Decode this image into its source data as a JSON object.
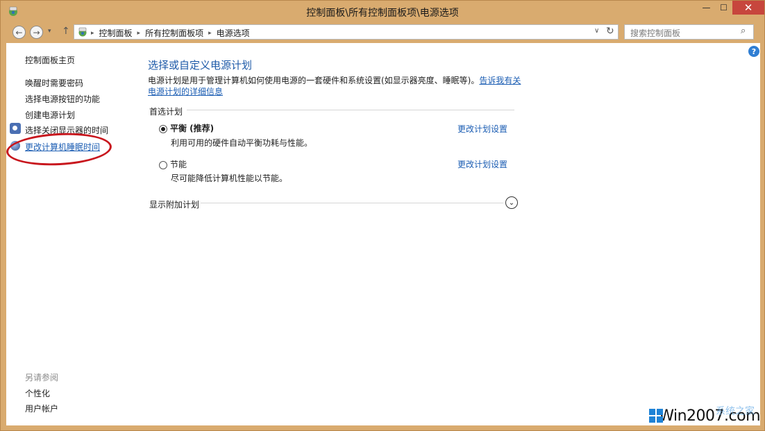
{
  "window": {
    "title": "控制面板\\所有控制面板项\\电源选项",
    "min_glyph": "—",
    "max_glyph": "☐",
    "close_glyph": "✕"
  },
  "nav": {
    "back_glyph": "←",
    "forward_glyph": "→",
    "history_glyph": "▾",
    "up_glyph": "↑",
    "breadcrumbs": [
      "控制面板",
      "所有控制面板项",
      "电源选项"
    ],
    "crumb_sep": "▸",
    "dropdown_glyph": "∨",
    "refresh_glyph": "↻"
  },
  "search": {
    "placeholder": "搜索控制面板",
    "icon_glyph": "⌕"
  },
  "help_glyph": "?",
  "sidebar": {
    "home": "控制面板主页",
    "items": [
      "唤醒时需要密码",
      "选择电源按钮的功能",
      "创建电源计划",
      "选择关闭显示器的时间",
      "更改计算机睡眠时间"
    ],
    "see_also_title": "另请参阅",
    "see_also": [
      "个性化",
      "用户帐户"
    ]
  },
  "main": {
    "heading": "选择或自定义电源计划",
    "description": "电源计划是用于管理计算机如何使用电源的一套硬件和系统设置(如显示器亮度、睡眠等)。",
    "description_link": "告诉我有关电源计划的详细信息",
    "preferred_title": "首选计划",
    "plans": [
      {
        "name": "平衡 (推荐)",
        "desc": "利用可用的硬件自动平衡功耗与性能。",
        "link": "更改计划设置",
        "selected": true
      },
      {
        "name": "节能",
        "desc": "尽可能降低计算机性能以节能。",
        "link": "更改计划设置",
        "selected": false
      }
    ],
    "extra_title": "显示附加计划",
    "expand_glyph": "⌄"
  },
  "watermark": {
    "text": "Win2007.com",
    "sub": "系统之家"
  }
}
